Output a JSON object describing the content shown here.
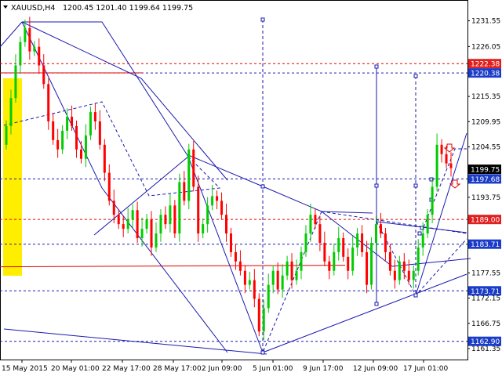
{
  "header": {
    "symbol_label": "XAUUSD,H4",
    "ohlc_label": "1200.45 1201.40 1199.64 1199.75"
  },
  "colors": {
    "bull": "#00cc00",
    "bear": "#ff0000",
    "lines": "#1a1ab0",
    "level_red": "#e00000",
    "tag_red": "#e02020",
    "tag_blue": "#1a3cc8",
    "tag_current": "#000000",
    "highlight": "#ffee00"
  },
  "chart_data": {
    "type": "candlestick",
    "symbol": "XAUUSD",
    "timeframe": "H4",
    "ylim": [
      1160,
      1235
    ],
    "y_ticks": [
      1231.55,
      1226.05,
      1220.38,
      1215.35,
      1209.95,
      1204.55,
      1199.75,
      1193.75,
      1189.0,
      1183.71,
      1177.55,
      1173.71,
      1172.15,
      1166.75,
      1162.9,
      1161.35
    ],
    "x_ticks": [
      "15 May 2015",
      "20 May 01:00",
      "22 May 17:00",
      "28 May 17:00",
      "2 Jun 09:00",
      "5 Jun 01:00",
      "9 Jun 17:00",
      "12 Jun 09:00",
      "17 Jun 01:00"
    ],
    "levels": [
      {
        "label": "1222.38",
        "value": 1222.38,
        "style": "red"
      },
      {
        "label": "1220.38",
        "value": 1220.38,
        "style": "blue"
      },
      {
        "label": "1197.68",
        "value": 1197.68,
        "style": "blue"
      },
      {
        "label": "1189.00",
        "value": 1189.0,
        "style": "red"
      },
      {
        "label": "1183.71",
        "value": 1183.71,
        "style": "blue"
      },
      {
        "label": "1173.71",
        "value": 1173.71,
        "style": "blue"
      },
      {
        "label": "1162.90",
        "value": 1162.9,
        "style": "blue"
      }
    ],
    "current_price": {
      "label": "1199.75",
      "value": 1199.75
    },
    "series": [
      {
        "name": "candles",
        "close": [
          1209,
          1215,
          1222,
          1227,
          1230,
          1225,
          1226,
          1222,
          1218,
          1210,
          1206,
          1204,
          1208,
          1211,
          1209,
          1204,
          1202,
          1207,
          1212,
          1210,
          1205,
          1199,
          1193,
          1190,
          1188,
          1187,
          1189,
          1191,
          1185,
          1187,
          1189,
          1183,
          1186,
          1190,
          1188,
          1192,
          1186,
          1197,
          1193,
          1204,
          1196,
          1186,
          1188,
          1192,
          1194,
          1193,
          1190,
          1186,
          1182,
          1180,
          1178,
          1175,
          1176,
          1172,
          1165,
          1170,
          1175,
          1178,
          1174,
          1177,
          1180,
          1176,
          1178,
          1182,
          1186,
          1190,
          1188,
          1184,
          1180,
          1178,
          1182,
          1185,
          1181,
          1178,
          1183,
          1186,
          1182,
          1175,
          1184,
          1188,
          1186,
          1182,
          1178,
          1176,
          1180,
          1178,
          1176,
          1178,
          1183,
          1186,
          1190,
          1196,
          1205,
          1203,
          1201,
          1200
        ]
      }
    ]
  }
}
